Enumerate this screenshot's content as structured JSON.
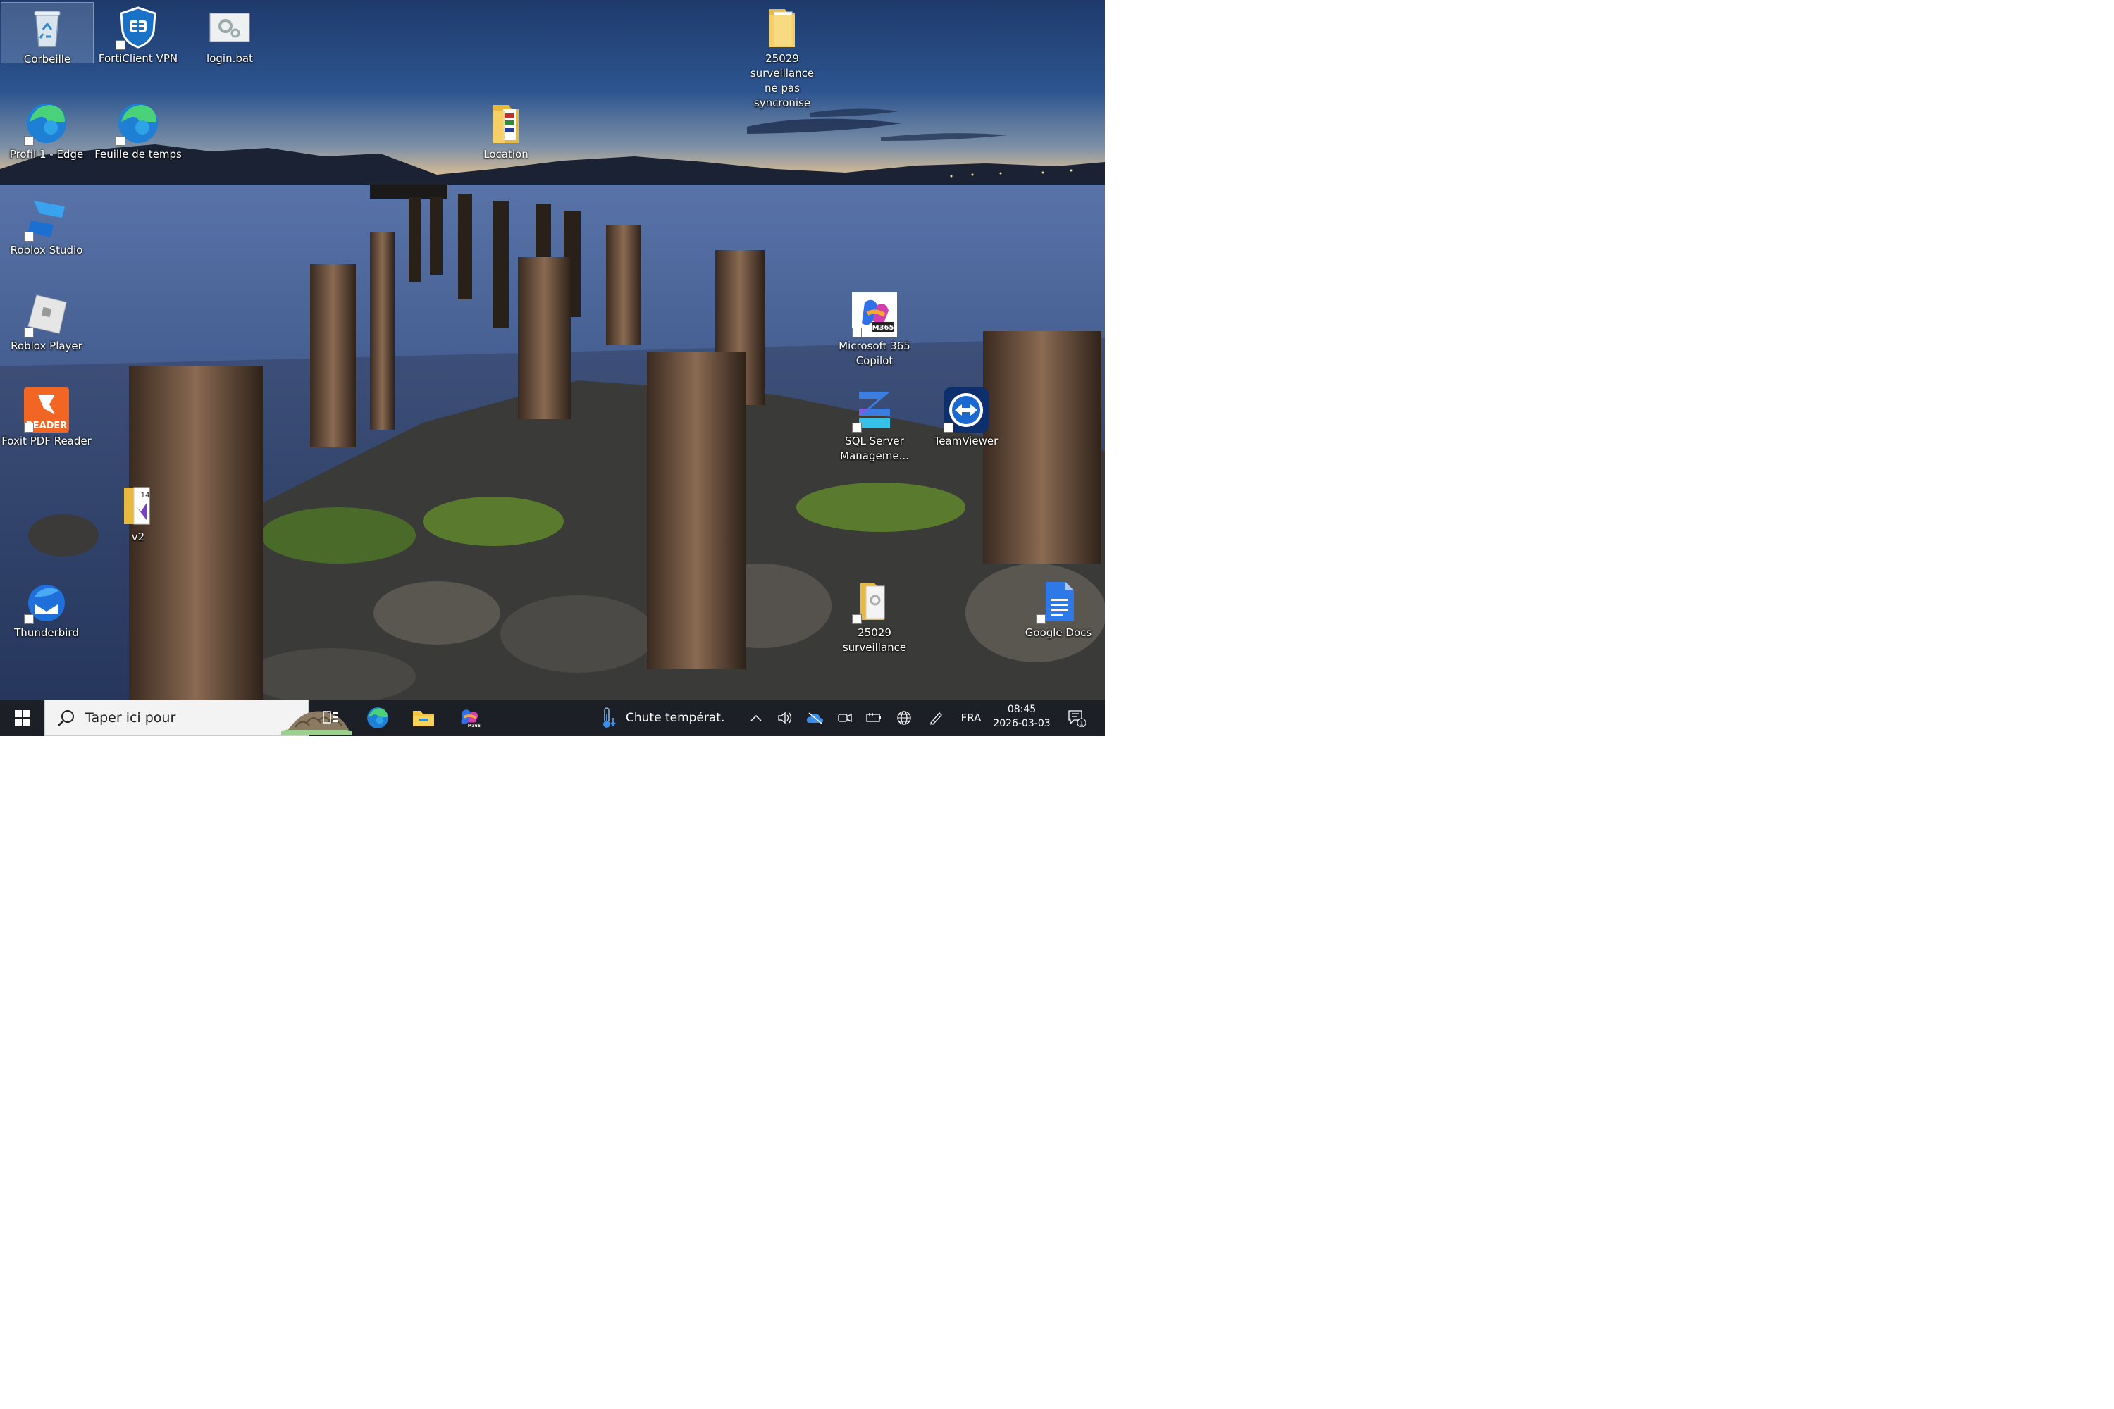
{
  "desktop": {
    "icons": [
      {
        "label": "Corbeille"
      },
      {
        "label": "FortiClient VPN"
      },
      {
        "label": "login.bat"
      },
      {
        "label": "25029 surveillance\nne pas syncronise"
      },
      {
        "label": "Profil 1 - Edge"
      },
      {
        "label": "Feuille de temps"
      },
      {
        "label": "Location"
      },
      {
        "label": "Roblox Studio"
      },
      {
        "label": "Roblox Player"
      },
      {
        "label": "Microsoft 365\nCopilot",
        "badge": "M365"
      },
      {
        "label": "Foxit PDF Reader",
        "badge": "READER"
      },
      {
        "label": "SQL Server\nManageme..."
      },
      {
        "label": "TeamViewer"
      },
      {
        "label": "v2",
        "badge": "14"
      },
      {
        "label": "Thunderbird"
      },
      {
        "label": "25029 surveillance"
      },
      {
        "label": "Google Docs"
      }
    ]
  },
  "taskbar": {
    "search_placeholder": "Taper ici pour",
    "pinned": [
      "task-view",
      "edge",
      "file-explorer",
      "m365-copilot"
    ],
    "m365_badge": "M365",
    "weather_text": "Chute températ.",
    "language": "FRA",
    "time": "08:45",
    "date": "2026-03-03",
    "notification_count": "1"
  },
  "colors": {
    "taskbar_bg": "#1c1f26",
    "accent_blue": "#0078d4",
    "foxit_orange": "#f26522"
  }
}
